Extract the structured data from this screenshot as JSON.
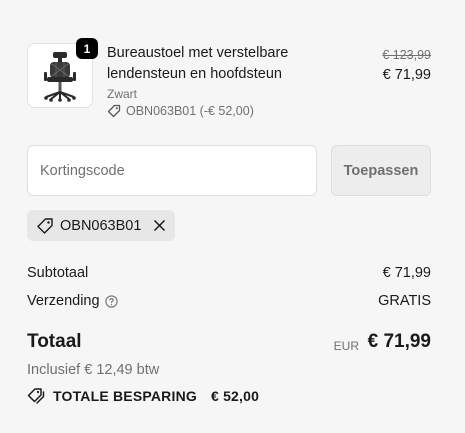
{
  "product": {
    "quantity": "1",
    "title": "Bureaustoel met verstelbare lendensteun en hoofdsteun",
    "variant": "Zwart",
    "discount_line": "OBN063B01 (-€ 52,00)",
    "price_original": "€ 123,99",
    "price_current": "€ 71,99"
  },
  "discount": {
    "placeholder": "Kortingscode",
    "apply_label": "Toepassen",
    "applied_code": "OBN063B01"
  },
  "totals": {
    "subtotal_label": "Subtotaal",
    "subtotal_value": "€ 71,99",
    "shipping_label": "Verzending",
    "shipping_value": "GRATIS",
    "total_label": "Totaal",
    "currency": "EUR",
    "total_value": "€ 71,99",
    "tax_line": "Inclusief € 12,49 btw",
    "savings_label": "TOTALE BESPARING",
    "savings_value": "€ 52,00"
  },
  "icons": [
    "chair-image",
    "tag-icon",
    "close-icon",
    "help-circle-icon",
    "tags-icon"
  ]
}
